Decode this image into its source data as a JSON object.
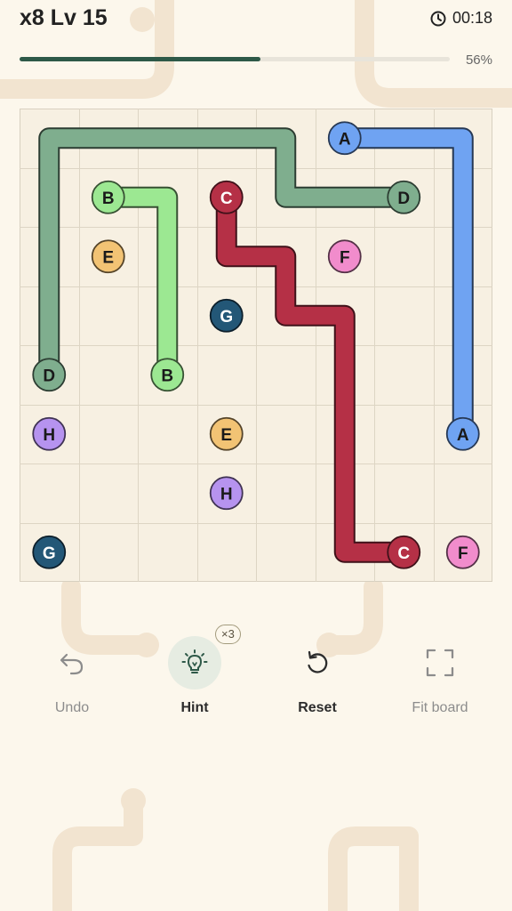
{
  "header": {
    "level_title": "x8 Lv 15",
    "timer": "00:18",
    "progress": 0.56,
    "progress_label": "56%"
  },
  "board": {
    "grid_size": 8,
    "colors": {
      "A": "#6fa3f2",
      "B": "#9ce892",
      "C": "#b53046",
      "D": "#7fae8e",
      "E": "#f2c374",
      "F": "#f18ccc",
      "G": "#235777",
      "H": "#b693ef"
    },
    "dots": [
      {
        "id": "A",
        "row": 0,
        "col": 5
      },
      {
        "id": "A",
        "row": 5,
        "col": 7
      },
      {
        "id": "B",
        "row": 1,
        "col": 1
      },
      {
        "id": "B",
        "row": 4,
        "col": 2
      },
      {
        "id": "C",
        "row": 1,
        "col": 3
      },
      {
        "id": "C",
        "row": 7,
        "col": 6
      },
      {
        "id": "D",
        "row": 1,
        "col": 6
      },
      {
        "id": "D",
        "row": 4,
        "col": 0
      },
      {
        "id": "E",
        "row": 2,
        "col": 1
      },
      {
        "id": "E",
        "row": 5,
        "col": 3
      },
      {
        "id": "F",
        "row": 2,
        "col": 5
      },
      {
        "id": "F",
        "row": 7,
        "col": 7
      },
      {
        "id": "G",
        "row": 3,
        "col": 3
      },
      {
        "id": "G",
        "row": 7,
        "col": 0
      },
      {
        "id": "H",
        "row": 5,
        "col": 0
      },
      {
        "id": "H",
        "row": 6,
        "col": 3
      }
    ],
    "paths": [
      {
        "id": "D",
        "cells": [
          [
            4,
            0
          ],
          [
            3,
            0
          ],
          [
            2,
            0
          ],
          [
            1,
            0
          ],
          [
            0,
            0
          ],
          [
            0,
            1
          ],
          [
            0,
            2
          ],
          [
            0,
            3
          ],
          [
            0,
            4
          ],
          [
            1,
            4
          ],
          [
            1,
            5
          ],
          [
            1,
            6
          ]
        ]
      },
      {
        "id": "A",
        "cells": [
          [
            0,
            5
          ],
          [
            0,
            6
          ],
          [
            0,
            7
          ],
          [
            1,
            7
          ],
          [
            2,
            7
          ],
          [
            3,
            7
          ],
          [
            4,
            7
          ],
          [
            5,
            7
          ]
        ]
      },
      {
        "id": "B",
        "cells": [
          [
            1,
            1
          ],
          [
            1,
            2
          ],
          [
            2,
            2
          ],
          [
            3,
            2
          ],
          [
            4,
            2
          ]
        ]
      },
      {
        "id": "C",
        "cells": [
          [
            1,
            3
          ],
          [
            2,
            3
          ],
          [
            2,
            4
          ],
          [
            3,
            4
          ],
          [
            3,
            5
          ],
          [
            4,
            5
          ],
          [
            5,
            5
          ],
          [
            6,
            5
          ],
          [
            7,
            5
          ],
          [
            7,
            6
          ]
        ]
      }
    ]
  },
  "toolbar": {
    "undo_label": "Undo",
    "hint_label": "Hint",
    "hint_count": "×3",
    "reset_label": "Reset",
    "fit_label": "Fit board"
  }
}
